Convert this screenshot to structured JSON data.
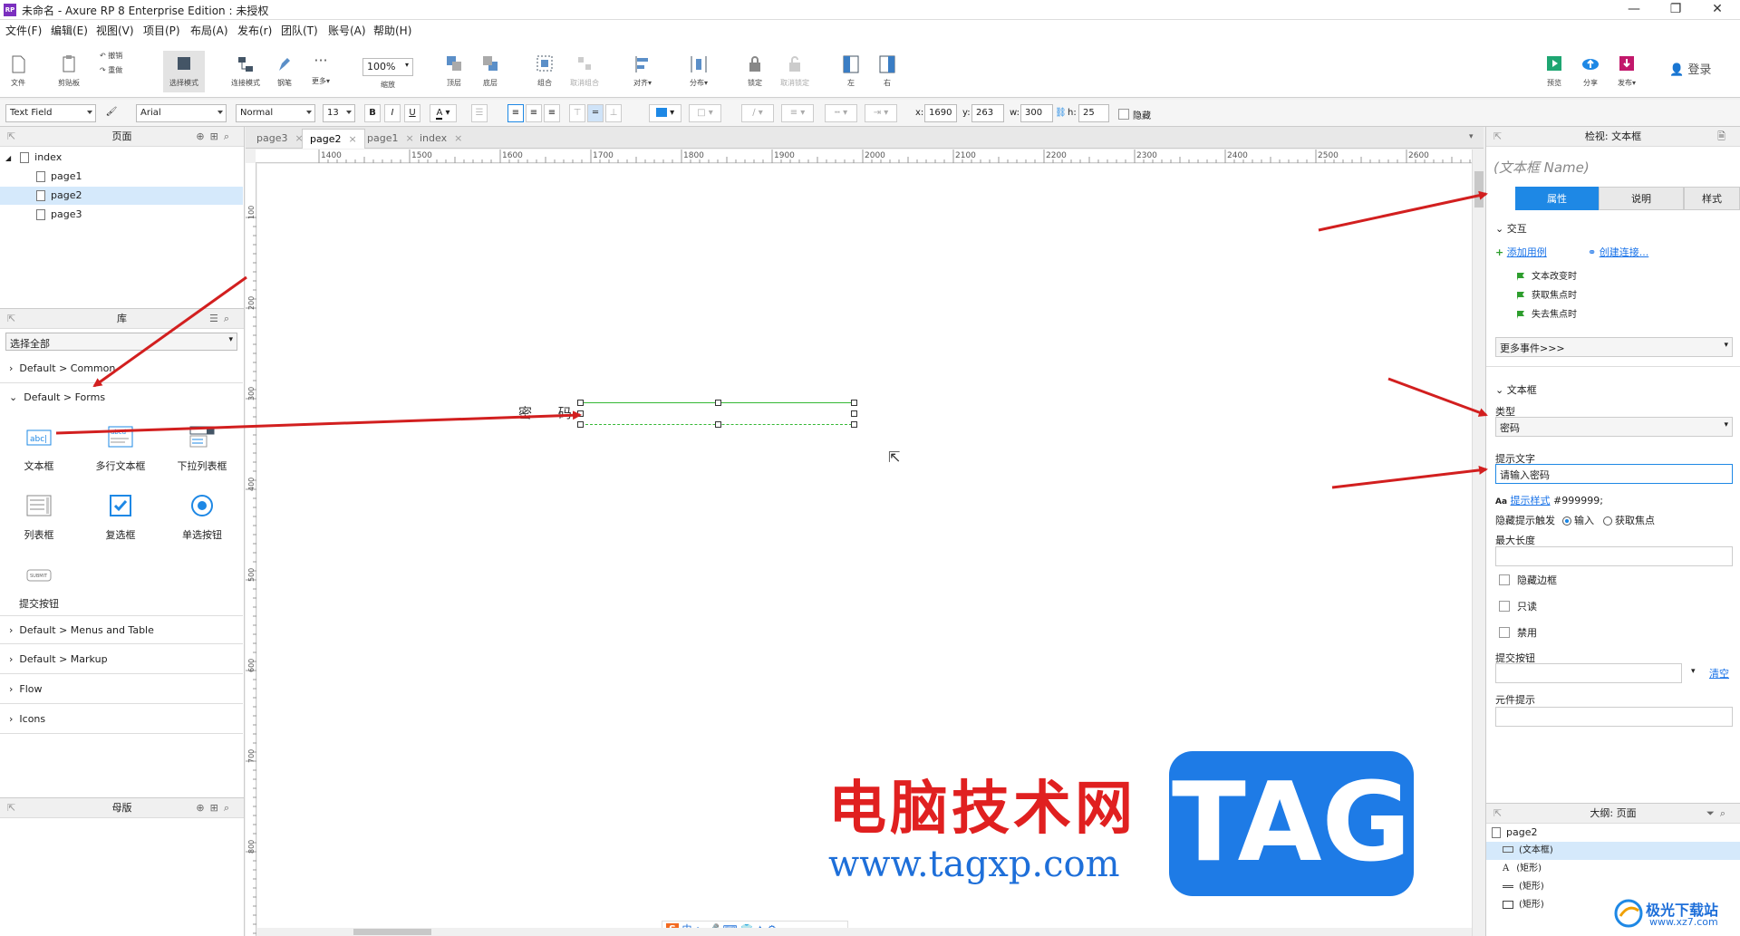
{
  "window": {
    "title": "未命名 - Axure RP 8 Enterprise Edition : 未授权",
    "app_icon": "RP"
  },
  "menubar": [
    "文件(F)",
    "编辑(E)",
    "视图(V)",
    "项目(P)",
    "布局(A)",
    "发布(r)",
    "团队(T)",
    "账号(A)",
    "帮助(H)"
  ],
  "toolbar": {
    "file": "文件",
    "clipboard": "剪贴板",
    "undo": "撤销",
    "redo": "重做",
    "select_mode": "选择模式",
    "connect_mode": "连接模式",
    "pen": "钢笔",
    "more": "更多▾",
    "zoom_value": "100%",
    "zoom_label": "缩放",
    "top": "顶层",
    "bottom": "底层",
    "group": "组合",
    "ungroup": "取消组合",
    "align": "对齐▾",
    "distribute": "分布▾",
    "lock": "锁定",
    "unlock": "取消锁定",
    "left": "左",
    "right": "右",
    "preview": "预览",
    "share": "分享",
    "publish": "发布▾",
    "login": "登录"
  },
  "formatbar": {
    "widget_type": "Text Field",
    "font": "Arial",
    "style": "Normal",
    "size": "13",
    "bold": "B",
    "italic": "I",
    "underline": "U",
    "font_color": "A",
    "x_label": "x:",
    "x": "1690",
    "y_label": "y:",
    "y": "263",
    "w_label": "w:",
    "w": "300",
    "h_label": "h:",
    "h": "25",
    "hidden_label": "隐藏"
  },
  "pages_panel": {
    "title": "页面",
    "root": "index",
    "pages": [
      "page1",
      "page2",
      "page3"
    ],
    "selected": "page2"
  },
  "library_panel": {
    "title": "库",
    "selector": "选择全部",
    "groups_top": [
      "Default > Common",
      "Default > Forms"
    ],
    "widgets": [
      "文本框",
      "多行文本框",
      "下拉列表框",
      "列表框",
      "复选框",
      "单选按钮",
      "提交按钮"
    ],
    "widget_icon_text": {
      "textbox": "abc|",
      "multiline": "abcd",
      "submit": "SUBMIT"
    },
    "groups_bottom": [
      "Default > Menus and Table",
      "Default > Markup",
      "Flow",
      "Icons"
    ]
  },
  "masters_panel": {
    "title": "母版"
  },
  "tabs": [
    {
      "label": "page3",
      "active": false
    },
    {
      "label": "page2",
      "active": true
    },
    {
      "label": "page1",
      "active": false
    },
    {
      "label": "index",
      "active": false
    }
  ],
  "ruler_h": [
    "1400",
    "1500",
    "1600",
    "1700",
    "1800",
    "1900",
    "2000",
    "2100",
    "2200",
    "2300",
    "2400",
    "2500",
    "2600"
  ],
  "ruler_v": [
    "100",
    "200",
    "300",
    "400",
    "500",
    "600",
    "700",
    "800"
  ],
  "canvas": {
    "label": "密 码",
    "watermark_title": "电脑技术网",
    "watermark_url": "www.tagxp.com",
    "watermark_badge": "TAG",
    "corner_logo": "极光下载站",
    "corner_url": "www.xz7.com",
    "ime_label": "中"
  },
  "inspector": {
    "header": "检视: 文本框",
    "name_placeholder": "(文本框 Name)",
    "tabs": [
      "属性",
      "说明",
      "样式"
    ],
    "interaction_label": "交互",
    "add_case": "添加用例",
    "create_link": "创建连接...",
    "events": [
      "文本改变时",
      "获取焦点时",
      "失去焦点时"
    ],
    "more_events": "更多事件>>>",
    "textbox_section": "文本框",
    "type_label": "类型",
    "type_value": "密码",
    "hint_label": "提示文字",
    "hint_value": "请输入密码",
    "hint_style_prefix": "Aa",
    "hint_style_link": "提示样式",
    "hint_style_value": "#999999;",
    "hide_hint_label": "隐藏提示触发",
    "radio_input": "输入",
    "radio_focus": "获取焦点",
    "max_length_label": "最大长度",
    "checkboxes": [
      "隐藏边框",
      "只读",
      "禁用"
    ],
    "submit_label": "提交按钮",
    "clear": "清空",
    "tooltip_label": "元件提示"
  },
  "outline": {
    "title": "大纲: 页面",
    "root": "page2",
    "items": [
      {
        "label": "(文本框)",
        "selected": true
      },
      {
        "label": "(矩形)",
        "selected": false
      },
      {
        "label": "(矩形)",
        "selected": false
      },
      {
        "label": "(矩形)",
        "selected": false
      }
    ]
  },
  "colors": {
    "accent": "#1e88e5",
    "arrow": "#d21f1f",
    "watermark_red": "#e02020",
    "watermark_blue": "#1e6fd9",
    "badge_blue": "#1e7be6",
    "selection_green": "#35b835"
  }
}
